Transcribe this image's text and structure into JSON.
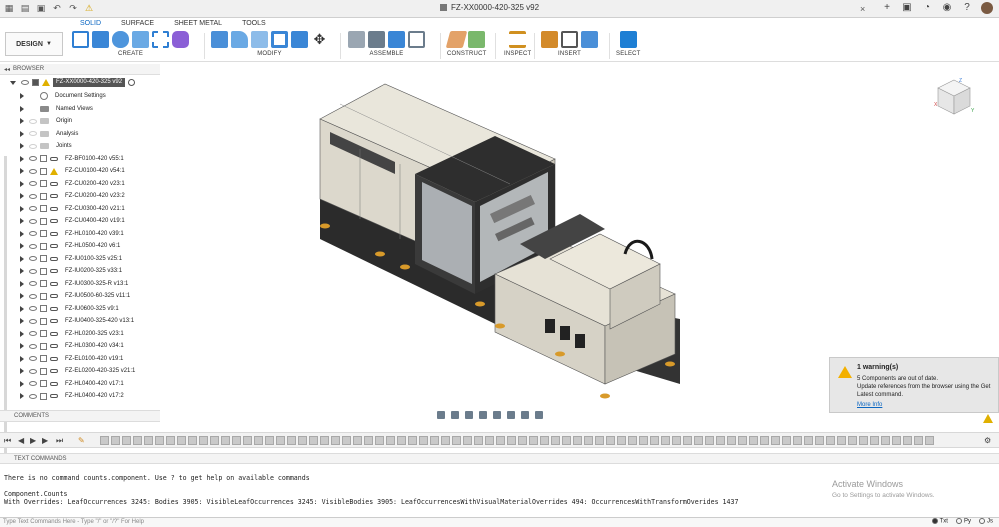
{
  "app": {
    "document_title": "FZ-XX0000-420-325 v92"
  },
  "ribbon": {
    "tabs": [
      {
        "label": "SOLID",
        "active": true
      },
      {
        "label": "SURFACE",
        "active": false
      },
      {
        "label": "SHEET METAL",
        "active": false
      },
      {
        "label": "TOOLS",
        "active": false
      }
    ],
    "workspace_button": "DESIGN",
    "groups": [
      {
        "label": "CREATE",
        "tools": [
          "new-sketch-icon",
          "extrude-icon",
          "revolve-icon",
          "sweep-icon",
          "pattern-icon",
          "form-icon"
        ]
      },
      {
        "label": "MODIFY",
        "tools": [
          "press-pull-icon",
          "fillet-icon",
          "chamfer-icon",
          "shell-icon",
          "combine-icon",
          "move-icon"
        ]
      },
      {
        "label": "ASSEMBLE",
        "tools": [
          "new-component-icon",
          "joint-icon",
          "as-built-joint-icon",
          "joint-origin-icon"
        ]
      },
      {
        "label": "CONSTRUCT",
        "tools": [
          "offset-plane-icon",
          "midplane-icon"
        ]
      },
      {
        "label": "INSPECT",
        "tools": [
          "measure-icon"
        ]
      },
      {
        "label": "INSERT",
        "tools": [
          "insert-derive-icon",
          "insert-mesh-icon",
          "canvas-icon"
        ]
      },
      {
        "label": "SELECT",
        "tools": [
          "select-icon"
        ]
      }
    ],
    "accent": "#0a66c2"
  },
  "browser": {
    "header": "BROWSER",
    "root": "FZ-XX0000-420-325 v92",
    "items": [
      {
        "label": "Document Settings",
        "kind": "settings"
      },
      {
        "label": "Named Views",
        "kind": "folder"
      },
      {
        "label": "Origin",
        "kind": "folder-faded"
      },
      {
        "label": "Analysis",
        "kind": "folder-faded"
      },
      {
        "label": "Joints",
        "kind": "folder-faded"
      },
      {
        "label": "FZ-BF0100-420 v55:1",
        "kind": "component"
      },
      {
        "label": "FZ-CU0100-420 v54:1",
        "kind": "component-warn"
      },
      {
        "label": "FZ-CU0200-420 v23:1",
        "kind": "component"
      },
      {
        "label": "FZ-CU0200-420 v23:2",
        "kind": "component"
      },
      {
        "label": "FZ-CU0300-420 v21:1",
        "kind": "component"
      },
      {
        "label": "FZ-CU0400-420 v19:1",
        "kind": "component"
      },
      {
        "label": "FZ-HL0100-420 v39:1",
        "kind": "component"
      },
      {
        "label": "FZ-HL0500-420 v6:1",
        "kind": "component"
      },
      {
        "label": "FZ-IU0100-325 v25:1",
        "kind": "component"
      },
      {
        "label": "FZ-IU0200-325 v33:1",
        "kind": "component"
      },
      {
        "label": "FZ-IU0300-325-R v13:1",
        "kind": "component"
      },
      {
        "label": "FZ-IU0500-60-325 v11:1",
        "kind": "component"
      },
      {
        "label": "FZ-IU0600-325 v9:1",
        "kind": "component"
      },
      {
        "label": "FZ-IU0400-325-420 v13:1",
        "kind": "component"
      },
      {
        "label": "FZ-HL0200-325 v23:1",
        "kind": "component"
      },
      {
        "label": "FZ-HL0300-420 v34:1",
        "kind": "component"
      },
      {
        "label": "FZ-EL0100-420 v19:1",
        "kind": "component"
      },
      {
        "label": "FZ-EL0200-420-325 v21:1",
        "kind": "component"
      },
      {
        "label": "FZ-HL0400-420 v17:1",
        "kind": "component"
      },
      {
        "label": "FZ-HL0400-420 v17:2",
        "kind": "component"
      }
    ]
  },
  "comments": {
    "label": "COMMENTS"
  },
  "warning": {
    "title": "1 warning(s)",
    "line1": "5 Components are out of date.",
    "line2": "Update references from the browser using the Get",
    "line3": "Latest command.",
    "link": "More Info"
  },
  "text_commands": {
    "header": "TEXT COMMANDS",
    "lines": [
      "There is no command counts.component. Use ? to get help on available commands",
      "",
      "Component.Counts",
      "With Overrides: LeafOccurrences 3245: Bodies 3905: VisibleLeafOccurrences 3245: VisibleBodies 3905: LeafOccurrencesWithVisualMaterialOverrides 494: OccurrencesWithTransformOverides 1437"
    ],
    "input_placeholder": "Type Text Commands Here - Type \"/\" or \"/?\" For Help",
    "modes": [
      {
        "label": "Txt",
        "selected": true
      },
      {
        "label": "Py",
        "selected": false
      },
      {
        "label": "Js",
        "selected": false
      }
    ]
  },
  "activation_watermark": {
    "title": "Activate Windows",
    "subtitle": "Go to Settings to activate Windows."
  },
  "viewcube": {
    "face_labels": [
      "Z",
      "X",
      "Y"
    ]
  }
}
